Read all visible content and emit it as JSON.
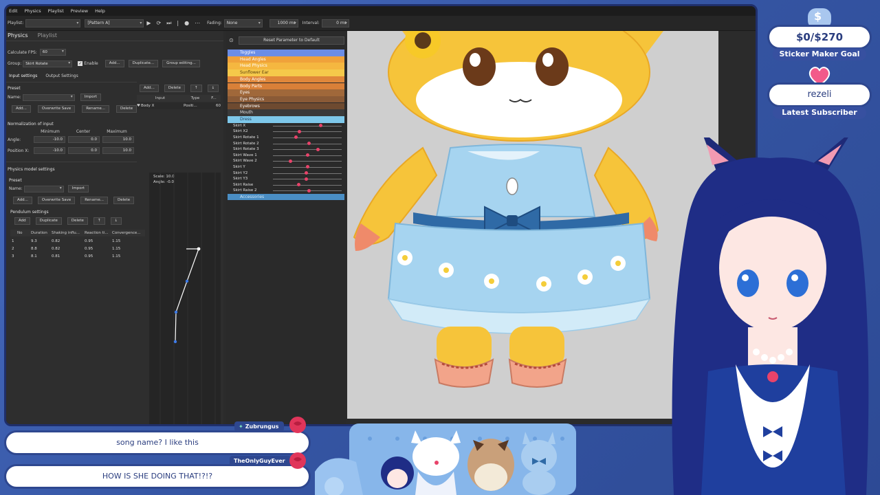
{
  "menubar": [
    "Edit",
    "Physics",
    "Playlist",
    "Preview",
    "Help"
  ],
  "toolbar": {
    "playlist_label": "Playlist:",
    "pattern_value": "[Pattern A]",
    "fading_label": "Fading:",
    "fading_value": "None",
    "duration_value": "1000 ms",
    "interval_label": "Interval:",
    "interval_value": "0 ms"
  },
  "left": {
    "tabs": [
      "Physics",
      "Playlist"
    ],
    "calc_fps_label": "Calculate FPS:",
    "calc_fps_value": "60",
    "group_label": "Group:",
    "group_value": "Skirt Rotate",
    "enable_label": "Enable",
    "add_label": "Add...",
    "duplicate_label": "Duplicate...",
    "group_editing_label": "Group editing...",
    "subtabs": [
      "Input settings",
      "Output Settings"
    ],
    "preset_label": "Preset",
    "name_label": "Name:",
    "import_label": "Import",
    "add_btn": "Add...",
    "overwrite_btn": "Overwrite Save",
    "rename_btn": "Rename...",
    "delete_btn": "Delete",
    "input_add": "Add...",
    "input_delete": "Delete",
    "input_up": "↑",
    "input_down": "↓",
    "input_headers": [
      "Input",
      "Type",
      "F..."
    ],
    "input_row": {
      "input": "Body X",
      "type": "Positi...",
      "f": "60"
    },
    "normalization_title": "Normalization of input",
    "norm_headers": [
      "Minimum",
      "Center",
      "Maximum"
    ],
    "norm_rows": [
      {
        "label": "Angle:",
        "min": "-10.0",
        "center": "0.0",
        "max": "10.0"
      },
      {
        "label": "Position X:",
        "min": "-10.0",
        "center": "0.0",
        "max": "10.0"
      }
    ],
    "model_settings_title": "Physics model settings",
    "pendulum_title": "Pendulum settings",
    "pendulum_add": "Add",
    "pendulum_duplicate": "Duplicate",
    "pendulum_delete": "Delete",
    "pendulum_headers": [
      "No",
      "Duration",
      "Shaking influ...",
      "Reaction ti...",
      "Convergence..."
    ],
    "pendulum_rows": [
      [
        "1",
        "9.3",
        "0.82",
        "0.95",
        "1.15"
      ],
      [
        "2",
        "8.8",
        "0.82",
        "0.95",
        "1.15"
      ],
      [
        "3",
        "8.1",
        "0.81",
        "0.95",
        "1.15"
      ]
    ],
    "graph_scale": "Scale: 10.0",
    "graph_angle": "Angle: -0.0"
  },
  "params": {
    "reset_label": "Reset Parameter to Default",
    "groups": [
      {
        "name": "Toggles",
        "color": "#6b8de6",
        "text": "#ffffff"
      },
      {
        "name": "Head Angles",
        "color": "#f0a23a",
        "text": "#ffffff"
      },
      {
        "name": "Head Physics",
        "color": "#f5b740",
        "text": "#ffffff"
      },
      {
        "name": "Sunflower Ear",
        "color": "#f5c94a",
        "text": "#5a4010"
      },
      {
        "name": "Body Angles",
        "color": "#e0873a",
        "text": "#ffffff"
      },
      {
        "name": "Body Parts",
        "color": "#d98038",
        "text": "#ffffff"
      },
      {
        "name": "Eyes",
        "color": "#a0683a",
        "text": "#ffffff"
      },
      {
        "name": "Eye Physics",
        "color": "#8a5a36",
        "text": "#ffffff"
      },
      {
        "name": "Eyebrows",
        "color": "#6e4a30",
        "text": "#ffffff"
      },
      {
        "name": "Mouth",
        "color": "#3a3a3a",
        "text": "#e0e0e0"
      },
      {
        "name": "Dress",
        "color": "#7ec8ea",
        "text": "#1d3a5a"
      }
    ],
    "rows": [
      {
        "name": "Skirt X",
        "value": 0.7
      },
      {
        "name": "Skirt X2",
        "value": 0.38
      },
      {
        "name": "Skirt Rotate 1",
        "value": 0.32
      },
      {
        "name": "Skirt Rotate 2",
        "value": 0.52
      },
      {
        "name": "Skirt Rotate 3",
        "value": 0.66
      },
      {
        "name": "Skirt Wave 1",
        "value": 0.5
      },
      {
        "name": "Skirt Wave 2",
        "value": 0.24
      },
      {
        "name": "Skirt Y",
        "value": 0.5
      },
      {
        "name": "Skirt Y2",
        "value": 0.48
      },
      {
        "name": "Skirt Y3",
        "value": 0.48
      },
      {
        "name": "Skirt Raise",
        "value": 0.36
      },
      {
        "name": "Skirt Raise 2",
        "value": 0.52
      }
    ],
    "accessories": "Accessories"
  },
  "overlay": {
    "goal_amount": "$0/$270",
    "goal_name": "Sticker Maker Goal",
    "subscriber_name": "rezeli",
    "subscriber_label": "Latest Subscriber"
  },
  "chat": [
    {
      "user": "Zubrungus",
      "message": "song name? I like this"
    },
    {
      "user": "TheOnlyGuyEver",
      "message": "HOW IS SHE DOING THAT!?!?"
    }
  ],
  "colors": {
    "frame": "#2e478f",
    "accent_pink": "#e8436a"
  }
}
